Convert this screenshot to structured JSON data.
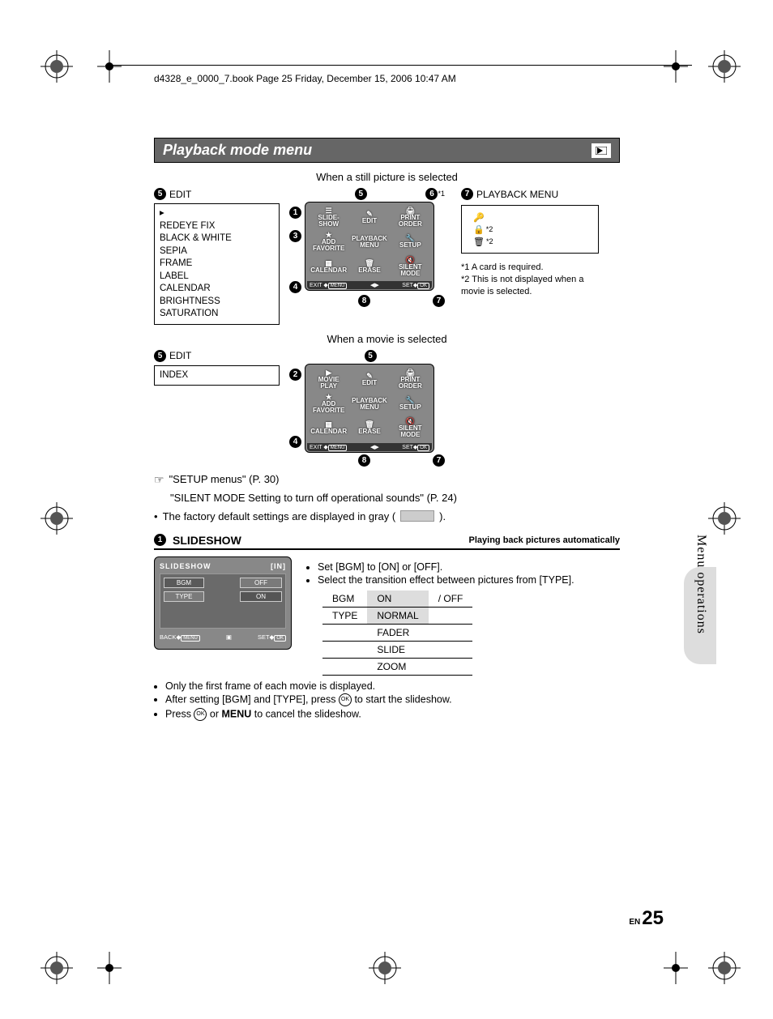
{
  "header": "d4328_e_0000_7.book  Page 25  Friday, December 15, 2006  10:47 AM",
  "title": "Playback mode menu",
  "caption_still": "When a still picture is selected",
  "caption_movie": "When a movie is selected",
  "edit_label": "EDIT",
  "edit_items_still": [
    "REDEYE FIX",
    "BLACK & WHITE",
    "SEPIA",
    "FRAME",
    "LABEL",
    "CALENDAR",
    "BRIGHTNESS",
    "SATURATION"
  ],
  "edit_items_movie": [
    "INDEX"
  ],
  "screen_items": {
    "tl": "SLIDE-\nSHOW",
    "tc": "EDIT",
    "tr": "PRINT\nORDER",
    "ml": "ADD\nFAVORITE",
    "mc": "PLAYBACK\nMENU",
    "mr": "SETUP",
    "bl": "CALENDAR",
    "bc": "ERASE",
    "br": "SILENT\nMODE",
    "exit": "EXIT",
    "menu": "MENU",
    "set": "SET",
    "ok": "OK"
  },
  "screen_movie_tl": "MOVIE\nPLAY",
  "callout_nums": {
    "one": "1",
    "two": "2",
    "three": "3",
    "four": "4",
    "five": "5",
    "six": "6",
    "six_star": "*1",
    "seven": "7",
    "eight": "8"
  },
  "playback_menu_label": "PLAYBACK MENU",
  "pb_items": [
    {
      "icon": "🔑",
      "sup": ""
    },
    {
      "icon": "🔒",
      "sup": "*2"
    },
    {
      "icon": "🗑",
      "sup": "*2"
    }
  ],
  "footnotes": {
    "f1": "*1 A card is required.",
    "f2": "*2 This is not displayed when a movie is selected."
  },
  "refs": [
    "\"SETUP menus\" (P. 30)",
    "\"SILENT MODE Setting to turn off operational sounds\" (P. 24)"
  ],
  "factory_line_a": "The factory default settings are displayed in gray (",
  "factory_line_b": ").",
  "section": {
    "num": "1",
    "title": "SLIDESHOW",
    "sub": "Playing back pictures automatically"
  },
  "lcd": {
    "title": "SLIDESHOW",
    "in": "[IN]",
    "left": [
      "BGM",
      "TYPE"
    ],
    "opts": [
      "OFF",
      "ON"
    ],
    "back": "BACK",
    "menu": "MENU",
    "set": "SET",
    "ok": "OK"
  },
  "slideshow_bullets": [
    "Set [BGM] to [ON] or [OFF].",
    "Select the transition effect between pictures from [TYPE]."
  ],
  "opts_table": {
    "rows": [
      {
        "k": "BGM",
        "v1": "ON",
        "v2": "/ OFF"
      },
      {
        "k": "TYPE",
        "v1": "NORMAL",
        "v2": ""
      },
      {
        "k": "",
        "v1": "FADER",
        "v2": ""
      },
      {
        "k": "",
        "v1": "SLIDE",
        "v2": ""
      },
      {
        "k": "",
        "v1": "ZOOM",
        "v2": ""
      }
    ]
  },
  "post_bullets": [
    "Only the first frame of each movie is displayed.",
    "After setting [BGM] and [TYPE], press ⊛ to start the slideshow.",
    "Press ⊛ or MENU to cancel the slideshow."
  ],
  "sidebar": "Menu operations",
  "pagenum": {
    "en": "EN",
    "num": "25"
  }
}
